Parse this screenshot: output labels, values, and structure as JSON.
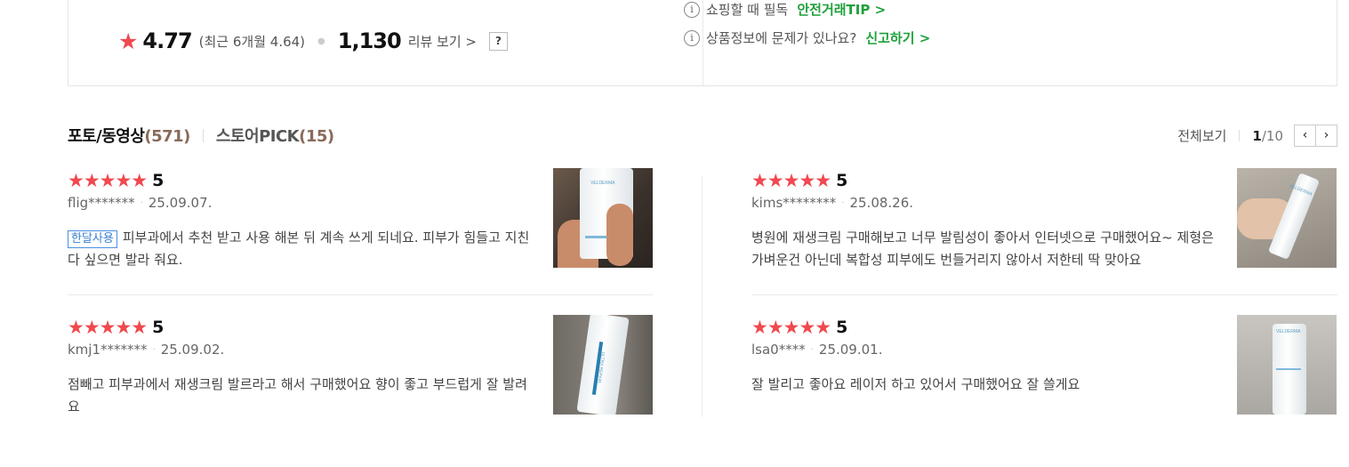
{
  "summary": {
    "rating": "4.77",
    "recent_rating": "(최근 6개월 4.64)",
    "review_count": "1,130",
    "review_link": "리뷰 보기 >",
    "help": "?",
    "info": [
      {
        "text": "쇼핑할 때 필독",
        "link": "안전거래TIP >"
      },
      {
        "text": "상품정보에 문제가 있나요?",
        "link": "신고하기 >"
      }
    ],
    "info_icon": "i",
    "colors": {
      "star": "#f0494f",
      "link_green": "#1fa03b"
    }
  },
  "tabs": [
    {
      "label": "포토/동영상",
      "count": "(571)",
      "active": true
    },
    {
      "label": "스토어PICK",
      "count": "(15)",
      "active": false
    }
  ],
  "pager": {
    "view_all": "전체보기",
    "current": "1",
    "total": "/10",
    "prev": "‹",
    "next": "›"
  },
  "reviews": [
    {
      "stars": "★★★★★",
      "score": "5",
      "user": "flig*******",
      "date": "25.09.07.",
      "badge": "한달사용",
      "text": "피부과에서 추천 받고 사용 해본 뒤 계속 쓰게 되네요. 피부가 힘들고 지친다 싶으면 발라 줘요.",
      "thumb_label": "VELDERMA"
    },
    {
      "stars": "★★★★★",
      "score": "5",
      "user": "kims********",
      "date": "25.08.26.",
      "badge": "",
      "text": "병원에 재생크림 구매해보고 너무 발림성이 좋아서 인터넷으로 구매했어요~ 제형은 가벼운건 아닌데 복합성 피부에도 번들거리지 않아서 저한테 딱 맞아요",
      "thumb_label": "VELDERMA"
    },
    {
      "stars": "★★★★★",
      "score": "5",
      "user": "kmj1*******",
      "date": "25.09.02.",
      "badge": "",
      "text": "점빼고 피부과에서 재생크림 발르라고 해서 구매했어요 향이 좋고 부드럽게 잘 발려요",
      "thumb_label": "ULTRA REPAIR"
    },
    {
      "stars": "★★★★★",
      "score": "5",
      "user": "lsa0****",
      "date": "25.09.01.",
      "badge": "",
      "text": "잘 발리고 좋아요 레이저 하고 있어서 구매했어요 잘 쓸게요",
      "thumb_label": "VELDERMA"
    }
  ]
}
